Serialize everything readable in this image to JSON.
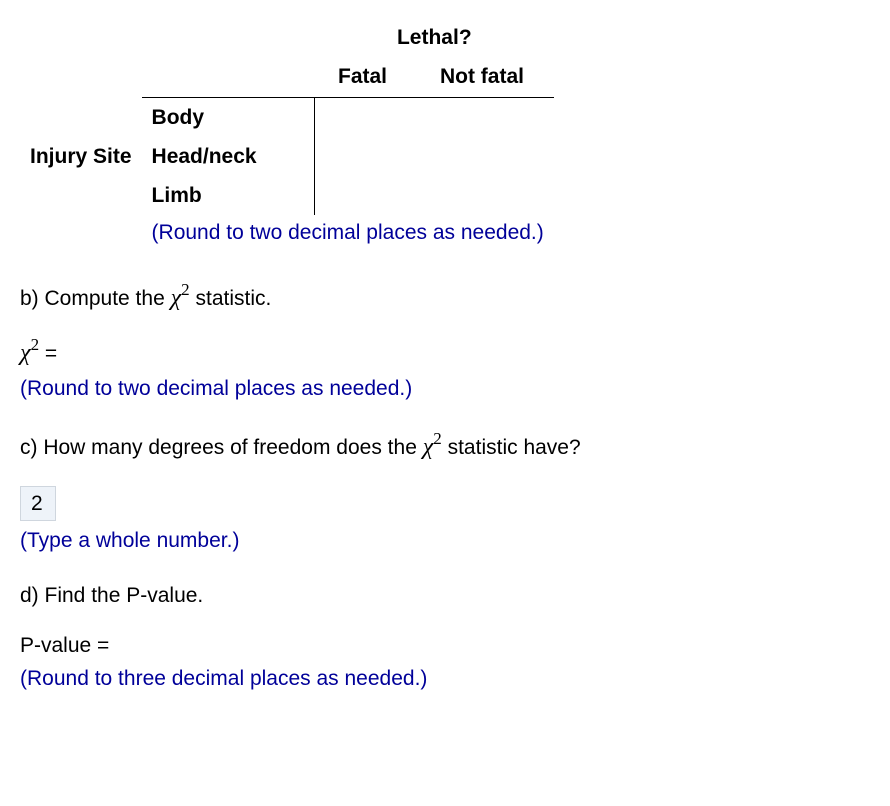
{
  "table": {
    "superheader": "Lethal?",
    "col_headers": [
      "Fatal",
      "Not fatal"
    ],
    "row_axis": "Injury Site",
    "row_categories": [
      "Body",
      "Head/neck",
      "Limb"
    ],
    "round_hint": "(Round to two decimal places as needed.)"
  },
  "part_b": {
    "prompt_prefix": "b) Compute the ",
    "prompt_suffix": " statistic.",
    "answer_prefix": " = ",
    "hint": "(Round to two decimal places as needed.)"
  },
  "part_c": {
    "prompt_prefix": "c) How many degrees of freedom does the ",
    "prompt_suffix": " statistic have?",
    "answer_value": "2",
    "hint": "(Type a whole number.)"
  },
  "part_d": {
    "prompt": "d) Find the P-value.",
    "answer_label": "P-value = ",
    "hint": "(Round to three decimal places as needed.)"
  },
  "symbols": {
    "chi": "χ",
    "sq": "2"
  }
}
